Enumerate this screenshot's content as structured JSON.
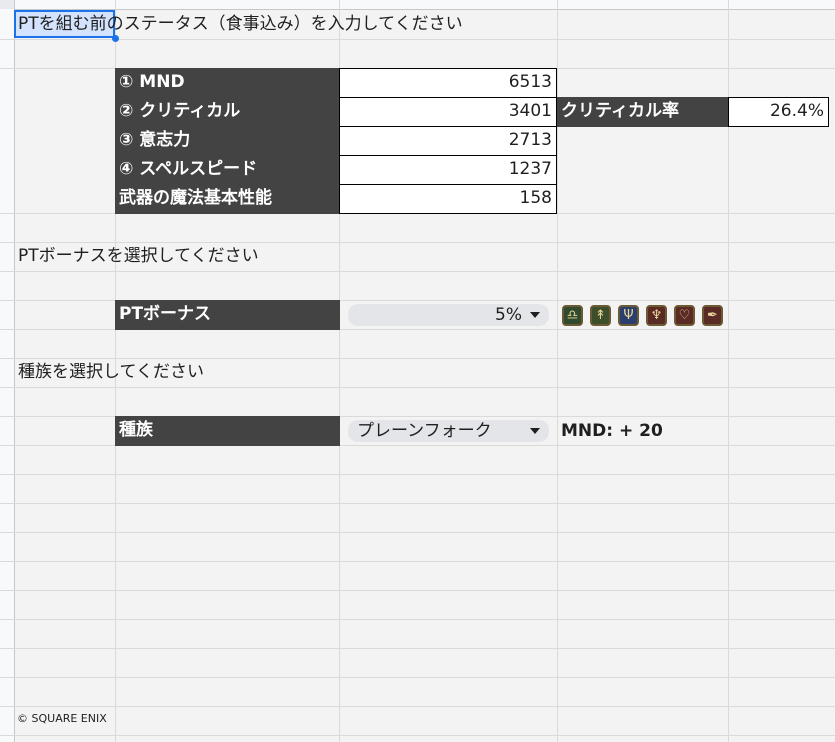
{
  "headings": {
    "status": "PTを組む前のステータス（食事込み）を入力してください",
    "pt_bonus": "PTボーナスを選択してください",
    "race": "種族を選択してください"
  },
  "stats": [
    {
      "label": "① MND",
      "value": "6513"
    },
    {
      "label": "② クリティカル",
      "value": "3401"
    },
    {
      "label": "③ 意志力",
      "value": "2713"
    },
    {
      "label": "④ スペルスピード",
      "value": "1237"
    },
    {
      "label": "武器の魔法基本性能",
      "value": "158"
    }
  ],
  "crit_rate": {
    "label": "クリティカル率",
    "value": "26.4%"
  },
  "pt_bonus": {
    "label": "PTボーナス",
    "selected": "5%"
  },
  "role_icons": [
    "balance-icon",
    "staff-icon",
    "trident-icon",
    "crest-icon",
    "heart-icon",
    "quill-icon"
  ],
  "race": {
    "label": "種族",
    "selected": "プレーンフォーク",
    "bonus": "MND: + 20"
  },
  "footer": {
    "copyright": "© SQUARE ENIX"
  },
  "colors": {
    "header_bg": "#434343",
    "header_fg": "#ffffff",
    "accent": "#1a73e8",
    "icon_bg": "#3b3a2c"
  }
}
